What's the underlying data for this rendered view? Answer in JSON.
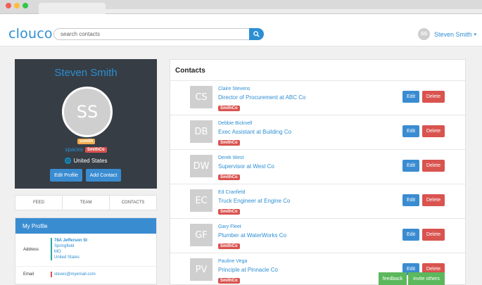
{
  "app": {
    "logo": "clouco",
    "search_placeholder": "search contacts",
    "user_initials": "SS",
    "user_name": "Steven Smith",
    "user_caret": "▾"
  },
  "profile": {
    "name": "Steven Smith",
    "initials": "SS",
    "tag": "ssmith",
    "spaces_label": "spaces",
    "company_badge": "SmithCo",
    "location": "United States",
    "edit_label": "Edit Profile",
    "add_label": "Add Contact"
  },
  "tabs": [
    "FEED",
    "TEAM",
    "CONTACTS"
  ],
  "my_profile": {
    "title": "My Profile",
    "address_label": "Address",
    "address_lines": [
      "78A Jefferson St",
      "Springfield",
      "MO",
      "United States"
    ],
    "email_label": "Email",
    "email_value": "steves@myemail.com"
  },
  "contacts": {
    "title": "Contacts",
    "edit_label": "Edit",
    "delete_label": "Delete",
    "items": [
      {
        "initials": "CS",
        "name": "Claire Stevens",
        "role": "Director of Procurement at ABC Co",
        "badge": "SmithCo"
      },
      {
        "initials": "DB",
        "name": "Debbie Bicknell",
        "role": "Exec Assistant at Building Co",
        "badge": "SmithCo"
      },
      {
        "initials": "DW",
        "name": "Derek West",
        "role": "Supervisor at West Co",
        "badge": "SmithCo"
      },
      {
        "initials": "EC",
        "name": "Ed Cranfield",
        "role": "Truck Engineer at Engine Co",
        "badge": "SmithCo"
      },
      {
        "initials": "GF",
        "name": "Gary Fleet",
        "role": "Plumber at WaterWorks Co",
        "badge": "SmithCo"
      },
      {
        "initials": "PV",
        "name": "Pauline Vega",
        "role": "Principle at Pinnacle Co",
        "badge": "SmithCo"
      }
    ]
  },
  "footer": {
    "feedback": "feedback",
    "invite": "invite others"
  },
  "colors": {
    "accent": "#2d8fd3",
    "card_dark": "#363d45",
    "danger": "#d9534f",
    "warning": "#f0ad4e",
    "success": "#5cb85c"
  }
}
